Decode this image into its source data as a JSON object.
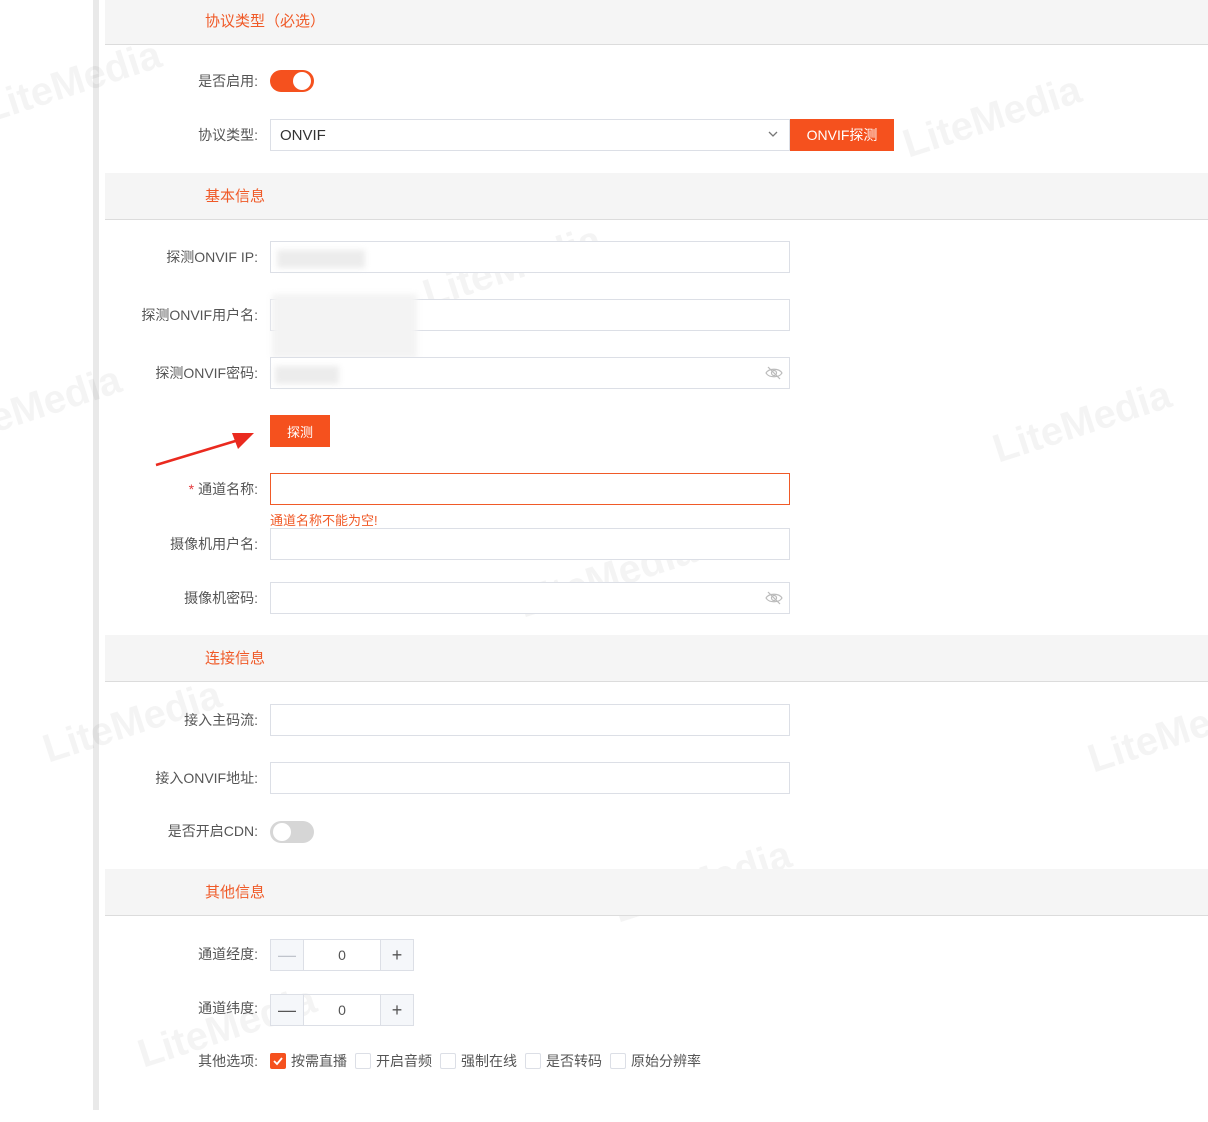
{
  "sections": {
    "protocol": "协议类型（必选）",
    "basic": "基本信息",
    "connection": "连接信息",
    "other": "其他信息"
  },
  "protocol": {
    "enable_label": "是否启用:",
    "enabled": true,
    "type_label": "协议类型:",
    "type_value": "ONVIF",
    "probe_button": "ONVIF探测"
  },
  "basic": {
    "probe_ip_label": "探测ONVIF IP:",
    "probe_user_label": "探测ONVIF用户名:",
    "probe_password_label": "探测ONVIF密码:",
    "probe_button": "探测",
    "channel_name_required": "*",
    "channel_name_label": "通道名称:",
    "channel_name_value": "",
    "channel_name_error": "通道名称不能为空!",
    "camera_user_label": "摄像机用户名:",
    "camera_password_label": "摄像机密码:"
  },
  "connection": {
    "main_stream_label": "接入主码流:",
    "onvif_address_label": "接入ONVIF地址:",
    "cdn_label": "是否开启CDN:",
    "cdn_enabled": false
  },
  "other": {
    "longitude_label": "通道经度:",
    "longitude_value": "0",
    "latitude_label": "通道纬度:",
    "latitude_value": "0",
    "options_label": "其他选项:",
    "options": [
      {
        "label": "按需直播",
        "checked": true
      },
      {
        "label": "开启音频",
        "checked": false
      },
      {
        "label": "强制在线",
        "checked": false
      },
      {
        "label": "是否转码",
        "checked": false
      },
      {
        "label": "原始分辨率",
        "checked": false
      }
    ]
  },
  "stepper_symbols": {
    "minus": "—",
    "plus": "+"
  },
  "watermark": "LiteMedia",
  "colors": {
    "accent": "#f5511e",
    "section_title": "#f05a28",
    "error": "#f05a28"
  },
  "icons": [
    "chevron-down-icon",
    "eye-off-icon",
    "check-icon",
    "arrow-annotation-icon"
  ]
}
